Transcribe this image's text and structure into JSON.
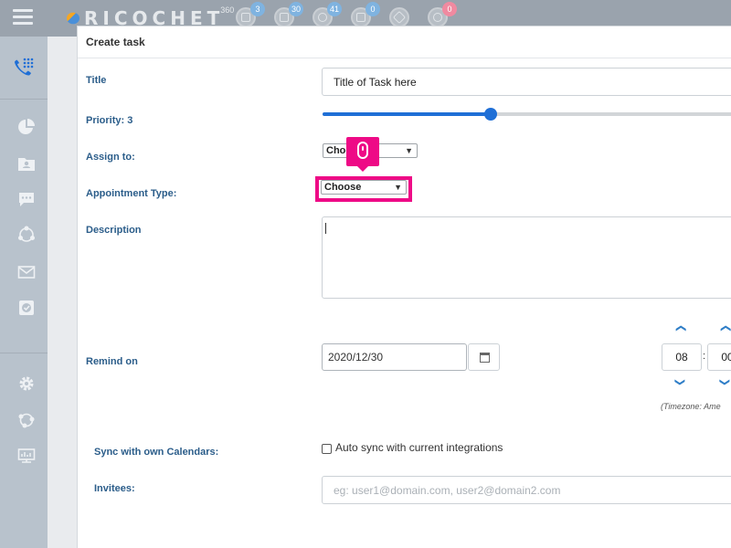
{
  "app": {
    "logo_text": "RICOCHET",
    "logo_sup": "360"
  },
  "topbar": {
    "icons": [
      {
        "name": "pdf-icon",
        "badge": "3",
        "badge_color": "#7fb3e0"
      },
      {
        "name": "document-icon",
        "badge": "30",
        "badge_color": "#7fb3e0"
      },
      {
        "name": "chat-icon",
        "badge": "41",
        "badge_color": "#7fb3e0"
      },
      {
        "name": "mail-icon",
        "badge": "0",
        "badge_color": "#7fb3e0"
      },
      {
        "name": "box-icon",
        "badge": "",
        "badge_color": ""
      },
      {
        "name": "message-icon",
        "badge": "0",
        "badge_color": "#f08aa0"
      }
    ]
  },
  "sidebar": {
    "items": [
      "phone-dialpad-icon",
      "pie-chart-icon",
      "contacts-icon",
      "chat-bubble-icon",
      "network-icon",
      "mail-icon",
      "task-check-icon",
      "settings-gear-icon",
      "integrations-icon",
      "dashboard-icon"
    ]
  },
  "dialog": {
    "title": "Create task",
    "fields": {
      "title_label": "Title",
      "title_value": "Title of Task here",
      "priority_label": "Priority: 3",
      "priority_value": 0.4,
      "assign_label": "Assign to:",
      "assign_value": "Choose",
      "appt_label": "Appointment Type:",
      "appt_value": "Choose",
      "desc_label": "Description",
      "remind_label": "Remind on",
      "remind_date": "2020/12/30",
      "remind_hour": "08",
      "remind_minute": "00",
      "timezone_note": "(Timezone: Ame",
      "sync_label": "Sync with own Calendars:",
      "sync_checkbox_label": "Auto sync with current integrations",
      "sync_checked": false,
      "invitees_label": "Invitees:",
      "invitees_placeholder": "eg: user1@domain.com, user2@domain2.com"
    }
  },
  "colors": {
    "accent": "#1f6fd6",
    "label": "#2b5d8a",
    "highlight": "#ee0a86"
  }
}
